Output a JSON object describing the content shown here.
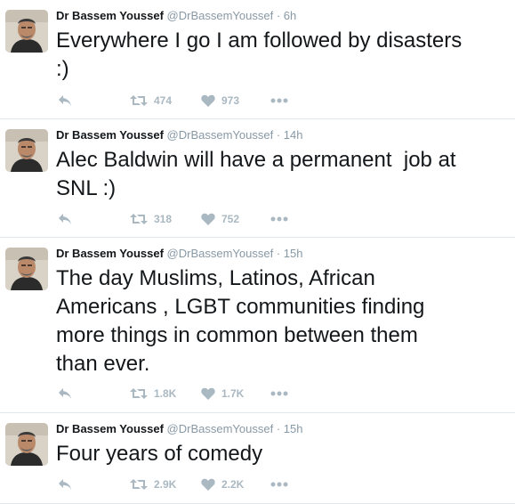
{
  "tweets": [
    {
      "name": "Dr Bassem Youssef",
      "handle": "@DrBassemYoussef",
      "sep": "·",
      "time": "6h",
      "text": "Everywhere I go I am followed by disasters\n:)",
      "retweets": "474",
      "likes": "973"
    },
    {
      "name": "Dr Bassem Youssef",
      "handle": "@DrBassemYoussef",
      "sep": "·",
      "time": "14h",
      "text": "Alec Baldwin will have a permanent  job at\nSNL :)",
      "retweets": "318",
      "likes": "752"
    },
    {
      "name": "Dr Bassem Youssef",
      "handle": "@DrBassemYoussef",
      "sep": "·",
      "time": "15h",
      "text": "The day Muslims, Latinos, African\nAmericans , LGBT communities finding\nmore things in common between them\nthan ever.",
      "retweets": "1.8K",
      "likes": "1.7K"
    },
    {
      "name": "Dr Bassem Youssef",
      "handle": "@DrBassemYoussef",
      "sep": "·",
      "time": "15h",
      "text": "Four years of comedy",
      "retweets": "2.9K",
      "likes": "2.2K"
    }
  ],
  "icons": {
    "reply": "reply-icon",
    "retweet": "retweet-icon",
    "like": "heart-icon",
    "more": "more-icon"
  },
  "colors": {
    "text": "#14171a",
    "meta": "#8899a6",
    "action": "#aab8c2",
    "divider": "#e1e8ed"
  }
}
